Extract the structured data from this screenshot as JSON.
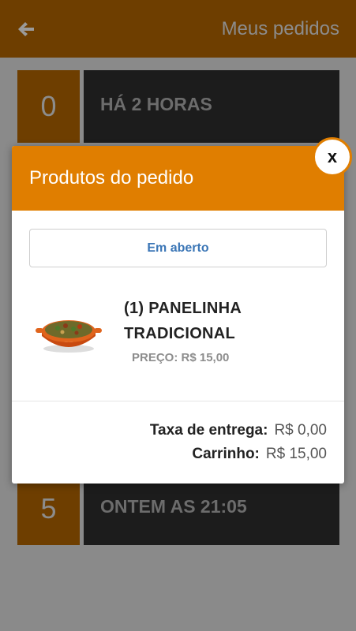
{
  "header": {
    "back_icon": "arrow-left-icon",
    "title": "Meus pedidos"
  },
  "orders": [
    {
      "number": "0",
      "time": "HÁ 2 HORAS"
    },
    {
      "number": "5",
      "time": "ONTEM AS 21:05"
    }
  ],
  "modal": {
    "title": "Produtos do pedido",
    "close_label": "x",
    "status_label": "Em aberto",
    "product": {
      "name": "(1) PANELINHA TRADICIONAL",
      "price": "PREÇO: R$ 15,00",
      "image_icon": "food-pot-image"
    },
    "totals": {
      "fee_label": "Taxa de entrega:",
      "fee_value": "R$ 0,00",
      "cart_label": "Carrinho:",
      "cart_value": "R$ 15,00"
    }
  },
  "colors": {
    "accent": "#e07e00",
    "dark_brown": "#6e3e00",
    "card_dark": "#1c1c1c",
    "link_blue": "#3b76b6"
  }
}
